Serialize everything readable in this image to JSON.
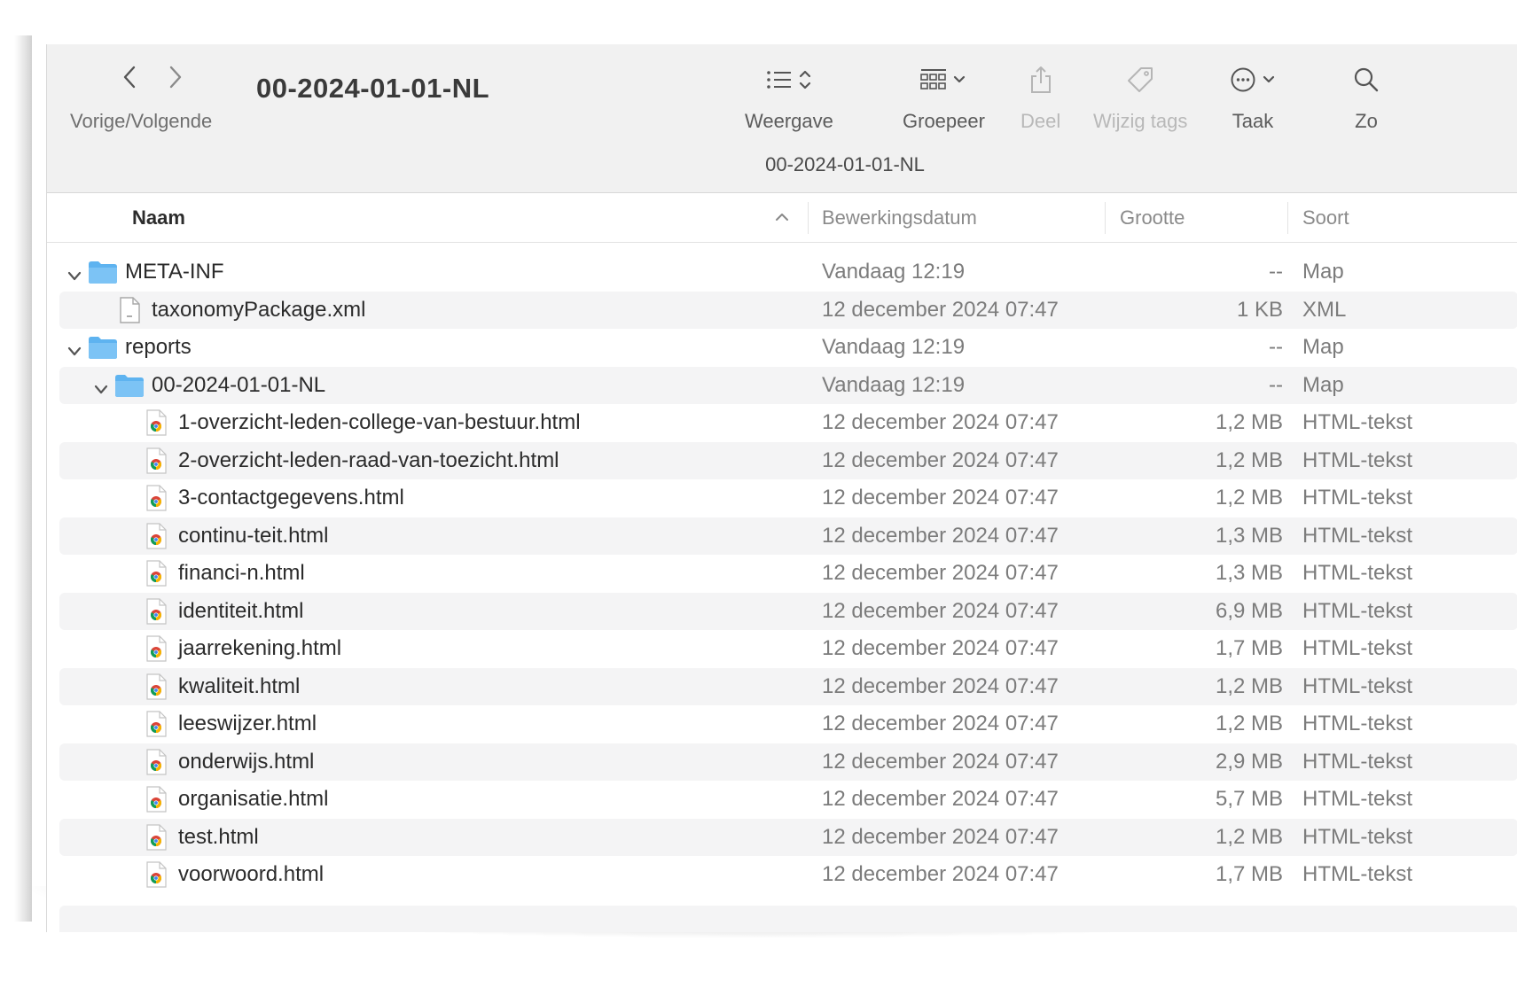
{
  "toolbar": {
    "nav_label": "Vorige/Volgende",
    "title": "00-2024-01-01-NL",
    "tools": {
      "view": "Weergave",
      "group": "Groepeer",
      "share": "Deel",
      "tags": "Wijzig tags",
      "action": "Taak",
      "search": "Zo"
    },
    "path_title": "00-2024-01-01-NL"
  },
  "columns": {
    "name": "Naam",
    "date": "Bewerkingsdatum",
    "size": "Grootte",
    "kind": "Soort"
  },
  "rows": [
    {
      "name": "META-INF",
      "date": "Vandaag 12:19",
      "size": "--",
      "kind": "Map",
      "icon": "folder-icon",
      "level": 0,
      "expanded": true
    },
    {
      "name": "taxonomyPackage.xml",
      "date": "12 december 2024 07:47",
      "size": "1 KB",
      "kind": "XML",
      "icon": "document-icon",
      "level": 1
    },
    {
      "name": "reports",
      "date": "Vandaag 12:19",
      "size": "--",
      "kind": "Map",
      "icon": "folder-icon",
      "level": 0,
      "expanded": true
    },
    {
      "name": "00-2024-01-01-NL",
      "date": "Vandaag 12:19",
      "size": "--",
      "kind": "Map",
      "icon": "folder-icon",
      "level": 1,
      "expanded": true
    },
    {
      "name": "1-overzicht-leden-college-van-bestuur.html",
      "date": "12 december 2024 07:47",
      "size": "1,2 MB",
      "kind": "HTML-tekst",
      "icon": "html-file-icon",
      "level": 2
    },
    {
      "name": "2-overzicht-leden-raad-van-toezicht.html",
      "date": "12 december 2024 07:47",
      "size": "1,2 MB",
      "kind": "HTML-tekst",
      "icon": "html-file-icon",
      "level": 2
    },
    {
      "name": "3-contactgegevens.html",
      "date": "12 december 2024 07:47",
      "size": "1,2 MB",
      "kind": "HTML-tekst",
      "icon": "html-file-icon",
      "level": 2
    },
    {
      "name": "continu-teit.html",
      "date": "12 december 2024 07:47",
      "size": "1,3 MB",
      "kind": "HTML-tekst",
      "icon": "html-file-icon",
      "level": 2
    },
    {
      "name": "financi-n.html",
      "date": "12 december 2024 07:47",
      "size": "1,3 MB",
      "kind": "HTML-tekst",
      "icon": "html-file-icon",
      "level": 2
    },
    {
      "name": "identiteit.html",
      "date": "12 december 2024 07:47",
      "size": "6,9 MB",
      "kind": "HTML-tekst",
      "icon": "html-file-icon",
      "level": 2
    },
    {
      "name": "jaarrekening.html",
      "date": "12 december 2024 07:47",
      "size": "1,7 MB",
      "kind": "HTML-tekst",
      "icon": "html-file-icon",
      "level": 2
    },
    {
      "name": "kwaliteit.html",
      "date": "12 december 2024 07:47",
      "size": "1,2 MB",
      "kind": "HTML-tekst",
      "icon": "html-file-icon",
      "level": 2
    },
    {
      "name": "leeswijzer.html",
      "date": "12 december 2024 07:47",
      "size": "1,2 MB",
      "kind": "HTML-tekst",
      "icon": "html-file-icon",
      "level": 2
    },
    {
      "name": "onderwijs.html",
      "date": "12 december 2024 07:47",
      "size": "2,9 MB",
      "kind": "HTML-tekst",
      "icon": "html-file-icon",
      "level": 2
    },
    {
      "name": "organisatie.html",
      "date": "12 december 2024 07:47",
      "size": "5,7 MB",
      "kind": "HTML-tekst",
      "icon": "html-file-icon",
      "level": 2
    },
    {
      "name": "test.html",
      "date": "12 december 2024 07:47",
      "size": "1,2 MB",
      "kind": "HTML-tekst",
      "icon": "html-file-icon",
      "level": 2
    },
    {
      "name": "voorwoord.html",
      "date": "12 december 2024 07:47",
      "size": "1,7 MB",
      "kind": "HTML-tekst",
      "icon": "html-file-icon",
      "level": 2
    }
  ],
  "colors": {
    "folder": "#5eb3f0",
    "toolbar_bg": "#f1f1f1",
    "row_alt": "#f4f4f5"
  }
}
